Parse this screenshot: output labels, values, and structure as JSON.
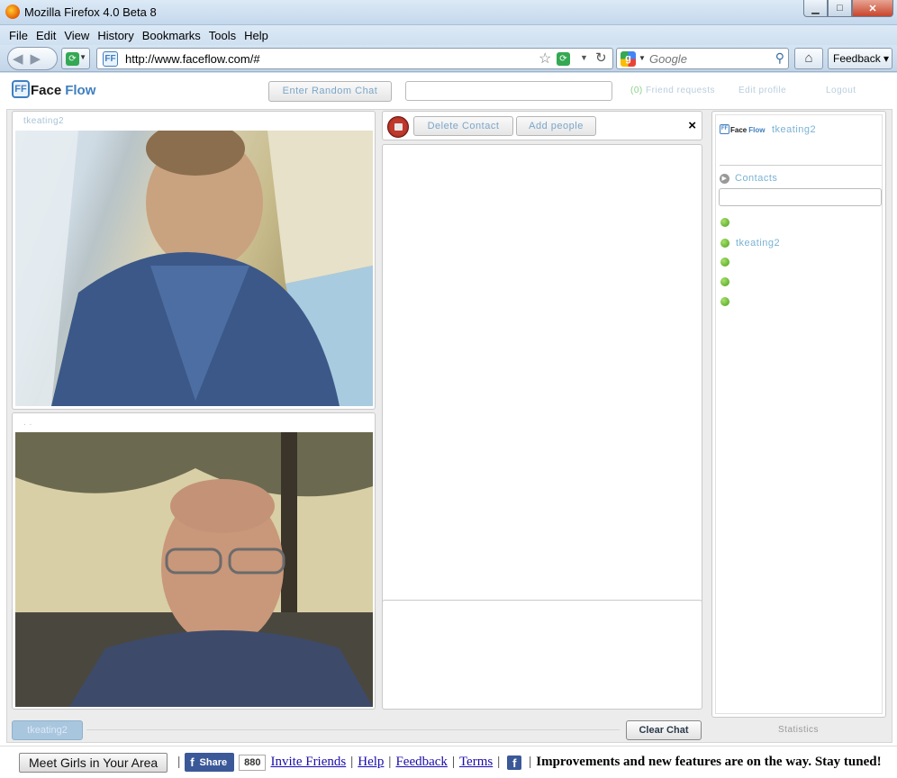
{
  "window": {
    "title": "Mozilla Firefox 4.0 Beta 8"
  },
  "menu": [
    "File",
    "Edit",
    "View",
    "History",
    "Bookmarks",
    "Tools",
    "Help"
  ],
  "nav": {
    "url": "http://www.faceflow.com/#",
    "search_placeholder": "Google",
    "feedback_label": "Feedback"
  },
  "app": {
    "logo_face": "Face",
    "logo_flow": "Flow",
    "logo_mark": "FF",
    "random_chat_label": "Enter Random Chat",
    "friend_requests_count": "(0)",
    "friend_requests_label": "Friend requests",
    "edit_profile_label": "Edit profile",
    "logout_label": "Logout"
  },
  "videos": [
    {
      "name": "tkeating2"
    },
    {
      "name": ". ."
    }
  ],
  "chat": {
    "delete_contact_label": "Delete Contact",
    "add_people_label": "Add people",
    "close_label": "×",
    "clear_chat_label": "Clear Chat",
    "active_tab_label": "tkeating2"
  },
  "sidebar": {
    "username": "tkeating2",
    "contacts_label": "Contacts",
    "contacts": [
      "",
      "tkeating2",
      "",
      "",
      ""
    ],
    "statistics_label": "Statistics"
  },
  "footer": {
    "meet_label": "Meet Girls in Your Area",
    "share_label": "Share",
    "share_count": "880",
    "links": [
      "Invite Friends",
      "Help",
      "Feedback",
      "Terms"
    ],
    "announcement": "Improvements and new features are on the way. Stay tuned!"
  },
  "colors": {
    "accent": "#3f7fc0",
    "online": "#4aa21a",
    "facebook": "#3b5998"
  }
}
